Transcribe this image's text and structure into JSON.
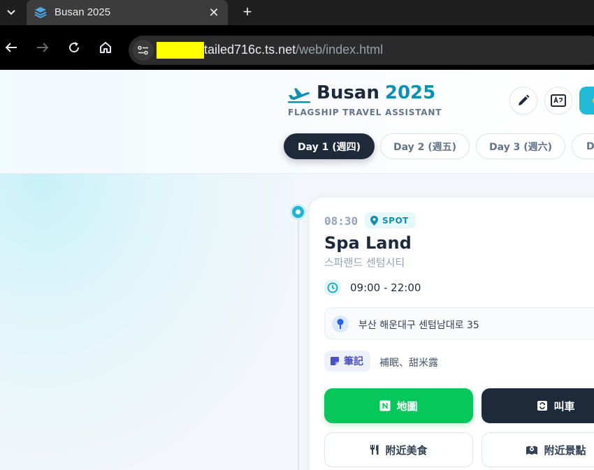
{
  "browser": {
    "tab_title": "Busan 2025",
    "url_host": "tailed716c.ts.net",
    "url_path": "/web/index.html"
  },
  "header": {
    "title": "Busan",
    "year": "2025",
    "subtitle": "FLAGSHIP TRAVEL ASSISTANT",
    "brand_color": "#0e90b3"
  },
  "days": [
    {
      "label": "Day 1 (週四)",
      "active": true
    },
    {
      "label": "Day 2 (週五)",
      "active": false
    },
    {
      "label": "Day 3 (週六)",
      "active": false
    },
    {
      "label": "D",
      "active": false
    }
  ],
  "itinerary": [
    {
      "time": "08:30",
      "type": "SPOT",
      "name": "Spa Land",
      "local_name": "스파랜드 센텀시티",
      "hours": "09:00 - 22:00",
      "address": "부산 해운대구 센텀남대로 35",
      "note_label": "筆記",
      "note": "補眠、甜米露",
      "actions": {
        "map": "地圖",
        "taxi": "叫車",
        "food": "附近美食",
        "sights": "附近景點"
      }
    }
  ],
  "colors": {
    "accent": "#1fb4d4",
    "dark": "#1e2939",
    "map_green": "#05c75a"
  }
}
